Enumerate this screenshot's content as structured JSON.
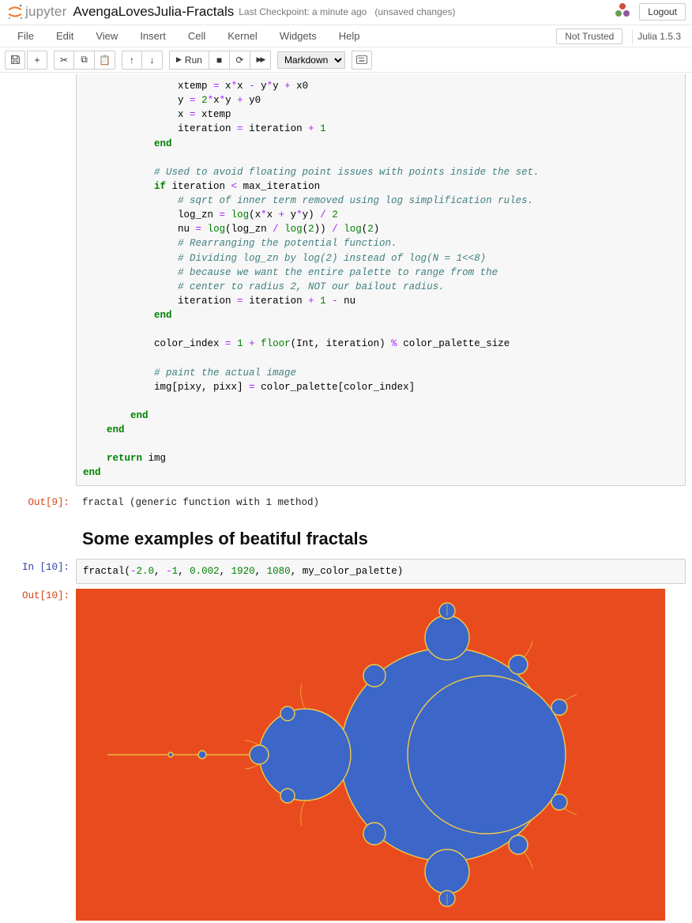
{
  "header": {
    "logo_text": "jupyter",
    "notebook_title": "AvengaLovesJulia-Fractals",
    "checkpoint_prefix": "Last Checkpoint:",
    "checkpoint_time": "a minute ago",
    "unsaved": "(unsaved changes)",
    "logout": "Logout"
  },
  "menubar": {
    "items": [
      "File",
      "Edit",
      "View",
      "Insert",
      "Cell",
      "Kernel",
      "Widgets",
      "Help"
    ],
    "not_trusted": "Not Trusted",
    "kernel": "Julia 1.5.3"
  },
  "toolbar": {
    "save_icon": "💾",
    "add_icon": "+",
    "cut_icon": "✂",
    "copy_icon": "⧉",
    "paste_icon": "📋",
    "up_icon": "↑",
    "down_icon": "↓",
    "run_icon": "▶",
    "run_label": "Run",
    "stop_icon": "■",
    "restart_icon": "⟳",
    "restart_run_icon": "▶▶",
    "celltype_selected": "Markdown",
    "cmd_icon": "⌘"
  },
  "cells": {
    "code9_tokens": [
      {
        "t": "                xtemp ",
        "c": ""
      },
      {
        "t": "=",
        "c": "tok-op"
      },
      {
        "t": " x",
        "c": ""
      },
      {
        "t": "*",
        "c": "tok-op"
      },
      {
        "t": "x ",
        "c": ""
      },
      {
        "t": "-",
        "c": "tok-op"
      },
      {
        "t": " y",
        "c": ""
      },
      {
        "t": "*",
        "c": "tok-op"
      },
      {
        "t": "y ",
        "c": ""
      },
      {
        "t": "+",
        "c": "tok-op"
      },
      {
        "t": " x0\n",
        "c": ""
      },
      {
        "t": "                y ",
        "c": ""
      },
      {
        "t": "=",
        "c": "tok-op"
      },
      {
        "t": " ",
        "c": ""
      },
      {
        "t": "2",
        "c": "tok-num"
      },
      {
        "t": "*",
        "c": "tok-op"
      },
      {
        "t": "x",
        "c": ""
      },
      {
        "t": "*",
        "c": "tok-op"
      },
      {
        "t": "y ",
        "c": ""
      },
      {
        "t": "+",
        "c": "tok-op"
      },
      {
        "t": " y0\n",
        "c": ""
      },
      {
        "t": "                x ",
        "c": ""
      },
      {
        "t": "=",
        "c": "tok-op"
      },
      {
        "t": " xtemp\n",
        "c": ""
      },
      {
        "t": "                iteration ",
        "c": ""
      },
      {
        "t": "=",
        "c": "tok-op"
      },
      {
        "t": " iteration ",
        "c": ""
      },
      {
        "t": "+",
        "c": "tok-op"
      },
      {
        "t": " ",
        "c": ""
      },
      {
        "t": "1",
        "c": "tok-num"
      },
      {
        "t": "\n",
        "c": ""
      },
      {
        "t": "            end",
        "c": "tok-kw"
      },
      {
        "t": "\n\n",
        "c": ""
      },
      {
        "t": "            # Used to avoid floating point issues with points inside the set.",
        "c": "tok-comment"
      },
      {
        "t": "\n",
        "c": ""
      },
      {
        "t": "            if",
        "c": "tok-kw"
      },
      {
        "t": " iteration ",
        "c": ""
      },
      {
        "t": "<",
        "c": "tok-op"
      },
      {
        "t": " max_iteration\n",
        "c": ""
      },
      {
        "t": "                # sqrt of inner term removed using log simplification rules.",
        "c": "tok-comment"
      },
      {
        "t": "\n",
        "c": ""
      },
      {
        "t": "                log_zn ",
        "c": ""
      },
      {
        "t": "=",
        "c": "tok-op"
      },
      {
        "t": " ",
        "c": ""
      },
      {
        "t": "log",
        "c": "tok-builtin"
      },
      {
        "t": "(x",
        "c": ""
      },
      {
        "t": "*",
        "c": "tok-op"
      },
      {
        "t": "x ",
        "c": ""
      },
      {
        "t": "+",
        "c": "tok-op"
      },
      {
        "t": " y",
        "c": ""
      },
      {
        "t": "*",
        "c": "tok-op"
      },
      {
        "t": "y) ",
        "c": ""
      },
      {
        "t": "/",
        "c": "tok-op"
      },
      {
        "t": " ",
        "c": ""
      },
      {
        "t": "2",
        "c": "tok-num"
      },
      {
        "t": "\n",
        "c": ""
      },
      {
        "t": "                nu ",
        "c": ""
      },
      {
        "t": "=",
        "c": "tok-op"
      },
      {
        "t": " ",
        "c": ""
      },
      {
        "t": "log",
        "c": "tok-builtin"
      },
      {
        "t": "(log_zn ",
        "c": ""
      },
      {
        "t": "/",
        "c": "tok-op"
      },
      {
        "t": " ",
        "c": ""
      },
      {
        "t": "log",
        "c": "tok-builtin"
      },
      {
        "t": "(",
        "c": ""
      },
      {
        "t": "2",
        "c": "tok-num"
      },
      {
        "t": ")) ",
        "c": ""
      },
      {
        "t": "/",
        "c": "tok-op"
      },
      {
        "t": " ",
        "c": ""
      },
      {
        "t": "log",
        "c": "tok-builtin"
      },
      {
        "t": "(",
        "c": ""
      },
      {
        "t": "2",
        "c": "tok-num"
      },
      {
        "t": ")\n",
        "c": ""
      },
      {
        "t": "                # Rearranging the potential function.",
        "c": "tok-comment"
      },
      {
        "t": "\n",
        "c": ""
      },
      {
        "t": "                # Dividing log_zn by log(2) instead of log(N = 1<<8)",
        "c": "tok-comment"
      },
      {
        "t": "\n",
        "c": ""
      },
      {
        "t": "                # because we want the entire palette to range from the",
        "c": "tok-comment"
      },
      {
        "t": "\n",
        "c": ""
      },
      {
        "t": "                # center to radius 2, NOT our bailout radius.",
        "c": "tok-comment"
      },
      {
        "t": "\n",
        "c": ""
      },
      {
        "t": "                iteration ",
        "c": ""
      },
      {
        "t": "=",
        "c": "tok-op"
      },
      {
        "t": " iteration ",
        "c": ""
      },
      {
        "t": "+",
        "c": "tok-op"
      },
      {
        "t": " ",
        "c": ""
      },
      {
        "t": "1",
        "c": "tok-num"
      },
      {
        "t": " ",
        "c": ""
      },
      {
        "t": "-",
        "c": "tok-op"
      },
      {
        "t": " nu\n",
        "c": ""
      },
      {
        "t": "            end",
        "c": "tok-kw"
      },
      {
        "t": "\n\n",
        "c": ""
      },
      {
        "t": "            color_index ",
        "c": ""
      },
      {
        "t": "=",
        "c": "tok-op"
      },
      {
        "t": " ",
        "c": ""
      },
      {
        "t": "1",
        "c": "tok-num"
      },
      {
        "t": " ",
        "c": ""
      },
      {
        "t": "+",
        "c": "tok-op"
      },
      {
        "t": " ",
        "c": ""
      },
      {
        "t": "floor",
        "c": "tok-builtin"
      },
      {
        "t": "(Int, iteration) ",
        "c": ""
      },
      {
        "t": "%",
        "c": "tok-op"
      },
      {
        "t": " color_palette_size\n\n",
        "c": ""
      },
      {
        "t": "            # paint the actual image",
        "c": "tok-comment"
      },
      {
        "t": "\n",
        "c": ""
      },
      {
        "t": "            img[pixy, pixx] ",
        "c": ""
      },
      {
        "t": "=",
        "c": "tok-op"
      },
      {
        "t": " color_palette[color_index]\n\n",
        "c": ""
      },
      {
        "t": "        end",
        "c": "tok-kw"
      },
      {
        "t": "\n",
        "c": ""
      },
      {
        "t": "    end",
        "c": "tok-kw"
      },
      {
        "t": "\n\n",
        "c": ""
      },
      {
        "t": "    return",
        "c": "tok-kw"
      },
      {
        "t": " img\n",
        "c": ""
      },
      {
        "t": "end",
        "c": "tok-kw"
      }
    ],
    "out9_prompt": "Out[9]:",
    "out9_text": "fractal (generic function with 1 method)",
    "md_heading": "Some examples of beatiful fractals",
    "in10_prompt": "In [10]:",
    "in10_tokens": [
      {
        "t": "fractal(",
        "c": ""
      },
      {
        "t": "-",
        "c": "tok-op"
      },
      {
        "t": "2.0",
        "c": "tok-num"
      },
      {
        "t": ", ",
        "c": ""
      },
      {
        "t": "-",
        "c": "tok-op"
      },
      {
        "t": "1",
        "c": "tok-num"
      },
      {
        "t": ", ",
        "c": ""
      },
      {
        "t": "0.002",
        "c": "tok-num"
      },
      {
        "t": ", ",
        "c": ""
      },
      {
        "t": "1920",
        "c": "tok-num"
      },
      {
        "t": ", ",
        "c": ""
      },
      {
        "t": "1080",
        "c": "tok-num"
      },
      {
        "t": ", my_color_palette)",
        "c": ""
      }
    ],
    "out10_prompt": "Out[10]:"
  },
  "colors": {
    "fractal_bg": "#e84c1e",
    "fractal_fg": "#3c67c8",
    "fractal_edge": "#f0c94a"
  }
}
